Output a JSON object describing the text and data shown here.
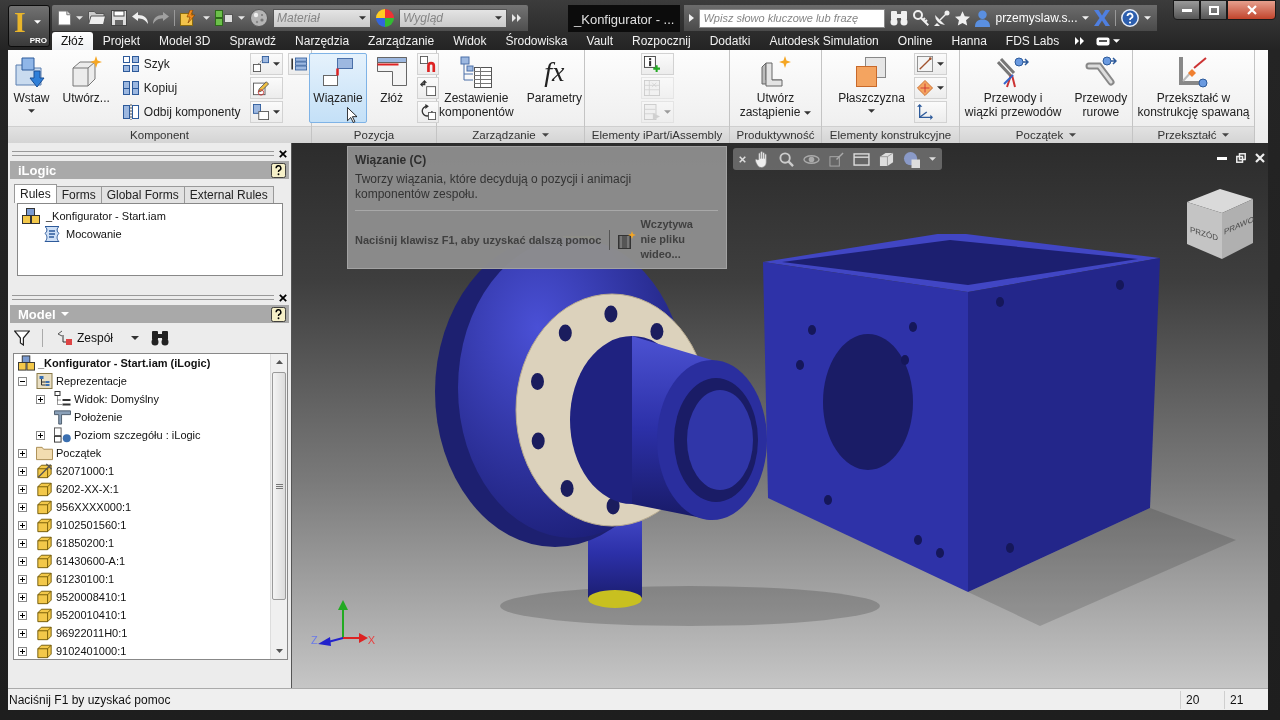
{
  "app_button": {
    "logo": "I",
    "edition": "PRO"
  },
  "quick_access": {
    "material": {
      "placeholder": "Materiał"
    },
    "appearance": {
      "placeholder": "Wygląd"
    }
  },
  "window": {
    "title": "_Konfigurator - ..."
  },
  "search": {
    "placeholder": "Wpisz słowo kluczowe lub frazę"
  },
  "user": {
    "name": "przemyslaw.s..."
  },
  "tabs": [
    {
      "label": "Złóż",
      "selected": true
    },
    {
      "label": "Projekt",
      "selected": false
    },
    {
      "label": "Model 3D",
      "selected": false
    },
    {
      "label": "Sprawdź",
      "selected": false
    },
    {
      "label": "Narzędzia",
      "selected": false
    },
    {
      "label": "Zarządzanie",
      "selected": false
    },
    {
      "label": "Widok",
      "selected": false
    },
    {
      "label": "Środowiska",
      "selected": false
    },
    {
      "label": "Vault",
      "selected": false
    },
    {
      "label": "Rozpocznij",
      "selected": false
    },
    {
      "label": "Dodatki",
      "selected": false
    },
    {
      "label": "Autodesk Simulation",
      "selected": false
    },
    {
      "label": "Online",
      "selected": false
    },
    {
      "label": "Hanna",
      "selected": false
    },
    {
      "label": "FDS Labs",
      "selected": false
    }
  ],
  "ribbon": {
    "panels": [
      {
        "label": "Komponent",
        "menu": false,
        "items": [
          {
            "kind": "large",
            "label": "Wstaw",
            "menu": true,
            "highlighted": false
          },
          {
            "kind": "large",
            "label": "Utwórz...",
            "menu": false,
            "highlighted": false
          },
          {
            "kind": "column",
            "buttons": [
              {
                "label": "Szyk",
                "menu": false,
                "disabled": false
              },
              {
                "label": "Kopiuj",
                "menu": false,
                "disabled": false
              },
              {
                "label": "Odbij komponenty",
                "menu": false,
                "disabled": false
              }
            ]
          },
          {
            "kind": "column",
            "buttons": [
              {
                "menu": true,
                "disabled": false
              },
              {
                "menu": false,
                "disabled": false
              },
              {
                "menu": true,
                "disabled": false
              }
            ]
          },
          {
            "kind": "column",
            "buttons": [
              {
                "menu": false,
                "disabled": false
              }
            ]
          }
        ]
      },
      {
        "label": "Pozycja",
        "menu": false,
        "items": [
          {
            "kind": "large",
            "label": "Wiązanie",
            "menu": false,
            "highlighted": true
          },
          {
            "kind": "large",
            "label": "Złóż",
            "menu": false,
            "highlighted": false
          },
          {
            "kind": "column",
            "buttons": [
              {
                "menu": false,
                "disabled": false
              },
              {
                "menu": false,
                "disabled": false
              },
              {
                "menu": false,
                "disabled": false
              }
            ]
          }
        ]
      },
      {
        "label": "Zarządzanie",
        "menu": true,
        "items": [
          {
            "kind": "large",
            "label": "Zestawienie\nkomponentów",
            "menu": false,
            "highlighted": false
          },
          {
            "kind": "large",
            "label": "Parametry",
            "glyph": "fx",
            "menu": false,
            "highlighted": false
          }
        ]
      },
      {
        "label": "Elementy iPart/iAssembly",
        "menu": false,
        "items": [
          {
            "kind": "column",
            "buttons": [
              {
                "menu": false,
                "disabled": false
              },
              {
                "menu": false,
                "disabled": true
              },
              {
                "menu": true,
                "disabled": true
              }
            ]
          }
        ]
      },
      {
        "label": "Produktywność",
        "menu": false,
        "items": [
          {
            "kind": "large",
            "label": "Utwórz\nzastąpienie",
            "menu": true,
            "highlighted": false
          }
        ]
      },
      {
        "label": "Elementy konstrukcyjne",
        "menu": false,
        "items": [
          {
            "kind": "large",
            "label": "Płaszczyzna",
            "menu": true,
            "highlighted": false
          },
          {
            "kind": "column",
            "buttons": [
              {
                "menu": true,
                "disabled": false
              },
              {
                "menu": true,
                "disabled": false
              },
              {
                "menu": false,
                "disabled": false
              }
            ]
          }
        ]
      },
      {
        "label": "Początek",
        "menu": true,
        "items": [
          {
            "kind": "large",
            "label": "Przewody i\nwiązki przewodów",
            "menu": false,
            "highlighted": false
          },
          {
            "kind": "large",
            "label": "Przewody\nrurowe",
            "menu": false,
            "highlighted": false
          }
        ]
      },
      {
        "label": "Przekształć",
        "menu": true,
        "items": [
          {
            "kind": "large",
            "label": "Przekształć w\nkonstrukcję spawaną",
            "menu": false,
            "highlighted": false
          }
        ]
      }
    ]
  },
  "tooltip": {
    "title": "Wiązanie (C)",
    "description": "Tworzy wiązania, które decydują o pozycji i animacji komponentów zespołu.",
    "help": "Naciśnij klawisz F1, aby uzyskać dalszą pomoc",
    "video": "Wczytywanie pliku wideo..."
  },
  "ilogic_panel": {
    "title": "iLogic",
    "tabs": [
      {
        "label": "Rules",
        "selected": true
      },
      {
        "label": "Forms",
        "selected": false
      },
      {
        "label": "Global Forms",
        "selected": false
      },
      {
        "label": "External Rules",
        "selected": false
      }
    ],
    "tree": [
      {
        "label": "_Konfigurator - Start.iam",
        "kind": "assembly",
        "children": [
          {
            "label": "Mocowanie",
            "kind": "rule"
          }
        ]
      }
    ]
  },
  "model_panel": {
    "title": "Model",
    "toolbar": {
      "filter_label": "Zespół"
    },
    "tree": [
      {
        "label": "_Konfigurator - Start.iam (iLogic)",
        "kind": "assembly",
        "expandable": false,
        "children": [
          {
            "label": "Reprezentacje",
            "kind": "representations",
            "expandable": true,
            "expanded": true,
            "children": [
              {
                "label": "Widok: Domyślny",
                "kind": "view",
                "expandable": true,
                "expanded": false
              },
              {
                "label": "Położenie",
                "kind": "position",
                "expandable": false
              },
              {
                "label": "Poziom szczegółu : iLogic",
                "kind": "detail_level",
                "expandable": true,
                "expanded": false
              }
            ]
          },
          {
            "label": "Początek",
            "kind": "folder",
            "expandable": true,
            "expanded": false
          },
          {
            "label": "62071000:1",
            "kind": "pinned_part",
            "expandable": true,
            "expanded": false
          },
          {
            "label": "6202-XX-X:1",
            "kind": "part",
            "expandable": true,
            "expanded": false
          },
          {
            "label": "956XXXX000:1",
            "kind": "part",
            "expandable": true,
            "expanded": false
          },
          {
            "label": "9102501560:1",
            "kind": "part",
            "expandable": true,
            "expanded": false
          },
          {
            "label": "61850200:1",
            "kind": "part",
            "expandable": true,
            "expanded": false
          },
          {
            "label": "61430600-A:1",
            "kind": "part",
            "expandable": true,
            "expanded": false
          },
          {
            "label": "61230100:1",
            "kind": "part",
            "expandable": true,
            "expanded": false
          },
          {
            "label": "9520008410:1",
            "kind": "part",
            "expandable": true,
            "expanded": false
          },
          {
            "label": "9520010410:1",
            "kind": "part",
            "expandable": true,
            "expanded": false
          },
          {
            "label": "96922011H0:1",
            "kind": "part",
            "expandable": true,
            "expanded": false
          },
          {
            "label": "9102401000:1",
            "kind": "part",
            "expandable": true,
            "expanded": false
          }
        ]
      }
    ]
  },
  "viewport": {
    "viewcube": {
      "faces": [
        "PRZÓD",
        "PRAWO"
      ]
    },
    "triad": {
      "labels": [
        "Z",
        "X"
      ]
    }
  },
  "status_bar": {
    "message": "Naciśnij F1 by uzyskać pomoc",
    "cells": [
      "20",
      "21"
    ]
  }
}
